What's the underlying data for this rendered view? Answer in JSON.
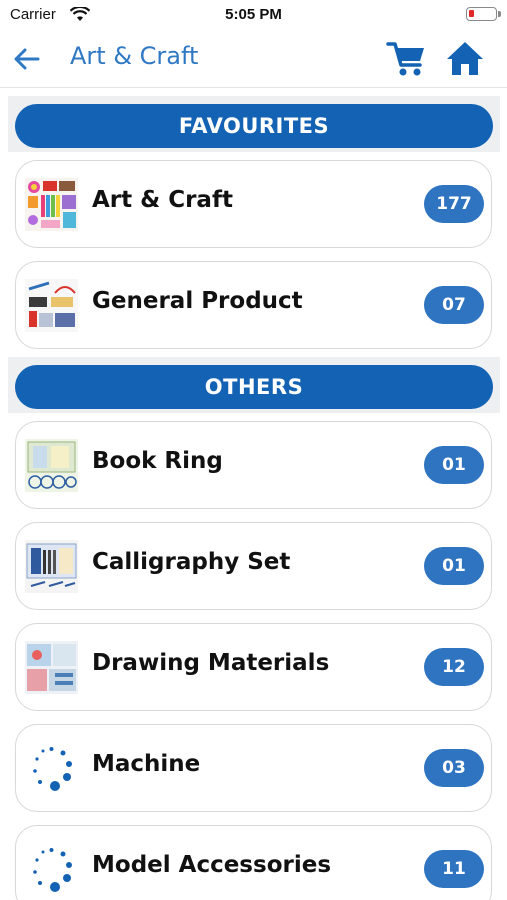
{
  "status_bar": {
    "carrier": "Carrier",
    "time": "5:05 PM"
  },
  "nav": {
    "title": "Art & Craft",
    "icons": [
      "back-arrow-icon",
      "cart-icon",
      "home-icon"
    ]
  },
  "colors": {
    "primary": "#1462b4",
    "badge": "#2f74c0",
    "title": "#2f78c4",
    "section_bg": "#eeeff1"
  },
  "favourites": {
    "label": "FAVOURITES",
    "items": [
      {
        "label": "Art & Craft",
        "count": "177"
      },
      {
        "label": "General Product",
        "count": "07"
      }
    ]
  },
  "others": {
    "label": "OTHERS",
    "items": [
      {
        "label": "Book Ring",
        "count": "01"
      },
      {
        "label": "Calligraphy Set",
        "count": "01"
      },
      {
        "label": "Drawing Materials",
        "count": "12"
      },
      {
        "label": "Machine",
        "count": "03"
      },
      {
        "label": "Model Accessories",
        "count": "11"
      }
    ]
  }
}
